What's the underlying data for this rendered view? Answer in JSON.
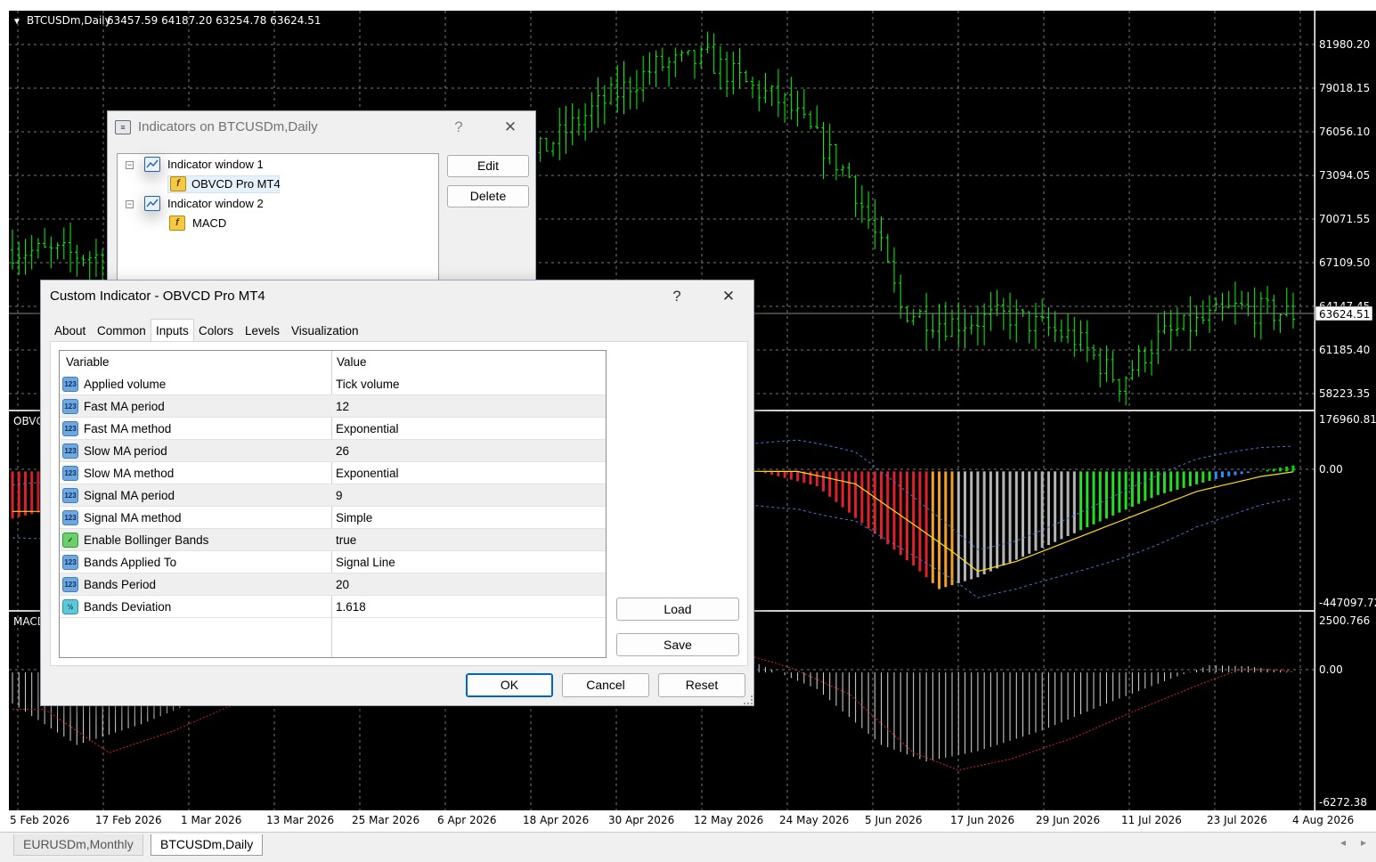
{
  "chart": {
    "header": "BTCUSDm,Daily",
    "ohlc": "63457.59 64187.20 63254.78 63624.51",
    "current_price": "63624.51",
    "price_ticks": [
      "81980.20",
      "79018.15",
      "76056.10",
      "73094.05",
      "70071.55",
      "67109.50",
      "64147.45",
      "61185.40",
      "58223.35"
    ],
    "obvcd_label": "OBVC",
    "obvcd_ticks": [
      "176960.813",
      "0.00",
      "-447097.729"
    ],
    "macd_label": "MACD",
    "macd_ticks": [
      "2500.766",
      "0.00",
      "-6272.38"
    ],
    "date_ticks": [
      "5 Feb 2026",
      "17 Feb 2026",
      "1 Mar 2026",
      "13 Mar 2026",
      "25 Mar 2026",
      "6 Apr 2026",
      "18 Apr 2026",
      "30 Apr 2026",
      "12 May 2026",
      "24 May 2026",
      "5 Jun 2026",
      "17 Jun 2026",
      "29 Jun 2026",
      "11 Jul 2026",
      "23 Jul 2026",
      "4 Aug 2026"
    ],
    "colors": {
      "bull": "#00ff00",
      "bear": "#ff2b2b",
      "grid": "#7a7a7a",
      "background": "#000000",
      "text": "#ffffff"
    }
  },
  "chart_tabs": [
    {
      "label": "EURUSDm,Monthly",
      "active": false
    },
    {
      "label": "BTCUSDm,Daily",
      "active": true
    }
  ],
  "indicators_window": {
    "title": "Indicators on BTCUSDm,Daily",
    "help": "?",
    "close": "✕",
    "tree": [
      {
        "label": "Indicator window 1",
        "icon": "indicator-window-icon",
        "expander": "−"
      },
      {
        "label": "OBVCD Pro MT4",
        "icon": "custom-indicator-icon",
        "glyph": "f"
      },
      {
        "label": "Indicator window 2",
        "icon": "indicator-window-icon",
        "expander": "−"
      },
      {
        "label": "MACD",
        "icon": "custom-indicator-icon",
        "glyph": "f"
      }
    ],
    "edit_label": "Edit",
    "delete_label": "Delete"
  },
  "custom_indicator_window": {
    "title": "Custom Indicator - OBVCD Pro MT4",
    "help": "?",
    "close": "✕",
    "tabs": [
      "About",
      "Common",
      "Inputs",
      "Colors",
      "Levels",
      "Visualization"
    ],
    "active_tab": "Inputs",
    "columns": {
      "variable": "Variable",
      "value": "Value"
    },
    "inputs": [
      {
        "variable": "Applied volume",
        "value": "Tick volume",
        "icon": "integer-icon",
        "glyph": "123"
      },
      {
        "variable": "Fast MA period",
        "value": "12",
        "icon": "integer-icon",
        "glyph": "123"
      },
      {
        "variable": "Fast MA method",
        "value": "Exponential",
        "icon": "integer-icon",
        "glyph": "123"
      },
      {
        "variable": "Slow MA period",
        "value": "26",
        "icon": "integer-icon",
        "glyph": "123"
      },
      {
        "variable": "Slow MA method",
        "value": "Exponential",
        "icon": "integer-icon",
        "glyph": "123"
      },
      {
        "variable": "Signal MA period",
        "value": "9",
        "icon": "integer-icon",
        "glyph": "123"
      },
      {
        "variable": "Signal MA method",
        "value": "Simple",
        "icon": "integer-icon",
        "glyph": "123"
      },
      {
        "variable": "Enable Bollinger Bands",
        "value": "true",
        "icon": "boolean-icon",
        "glyph": "✓"
      },
      {
        "variable": "Bands Applied To",
        "value": "Signal Line",
        "icon": "integer-icon",
        "glyph": "123"
      },
      {
        "variable": "Bands Period",
        "value": "20",
        "icon": "integer-icon",
        "glyph": "123"
      },
      {
        "variable": "Bands Deviation",
        "value": "1.618",
        "icon": "double-icon",
        "glyph": "½"
      }
    ],
    "load_label": "Load",
    "save_label": "Save",
    "ok_label": "OK",
    "cancel_label": "Cancel",
    "reset_label": "Reset"
  }
}
